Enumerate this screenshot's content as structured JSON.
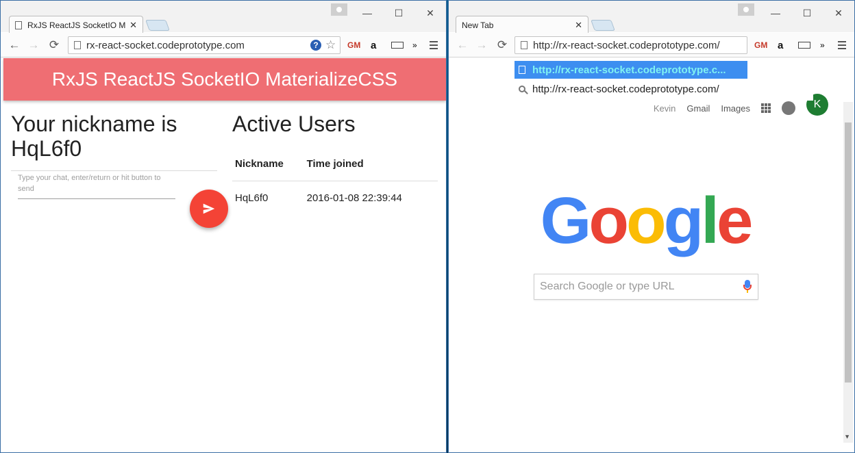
{
  "left_window": {
    "tab_title": "RxJS ReactJS SocketIO Ma",
    "url": "rx-react-socket.codeprototype.com",
    "app": {
      "header_title": "RxJS ReactJS SocketIO MaterializeCSS",
      "nickname_heading": "Your nickname is HqL6f0",
      "chat_placeholder": "Type your chat, enter/return or hit button to send",
      "active_users_heading": "Active Users",
      "table": {
        "headers": [
          "Nickname",
          "Time joined"
        ],
        "rows": [
          [
            "HqL6f0",
            "2016-01-08 22:39:44"
          ]
        ]
      }
    }
  },
  "right_window": {
    "tab_title": "New Tab",
    "url_typed": "http://rx-react-socket.codeprototype.com/",
    "suggestions": [
      "http://rx-react-socket.codeprototype.c...",
      "http://rx-react-socket.codeprototype.com/"
    ],
    "google_links": [
      "Kevin",
      "Gmail",
      "Images"
    ],
    "avatar_letter": "K",
    "logo_letters": [
      "G",
      "o",
      "o",
      "g",
      "l",
      "e"
    ],
    "logo_colors": [
      "#4285f4",
      "#ea4335",
      "#fbbc05",
      "#4285f4",
      "#34a853",
      "#ea4335"
    ],
    "search_placeholder": "Search Google or type URL"
  },
  "toolbar": {
    "back_icon": "←",
    "forward_icon": "→",
    "reload_icon": "⟳",
    "help_icon": "?",
    "star_icon": "☆",
    "gmail_ext": "GM",
    "amazon_ext": "a",
    "overflow": "»"
  },
  "window_controls": {
    "minimize": "—",
    "maximize": "☐",
    "close": "✕"
  },
  "accent_color": "#ef6e73",
  "fab_color": "#f44336"
}
